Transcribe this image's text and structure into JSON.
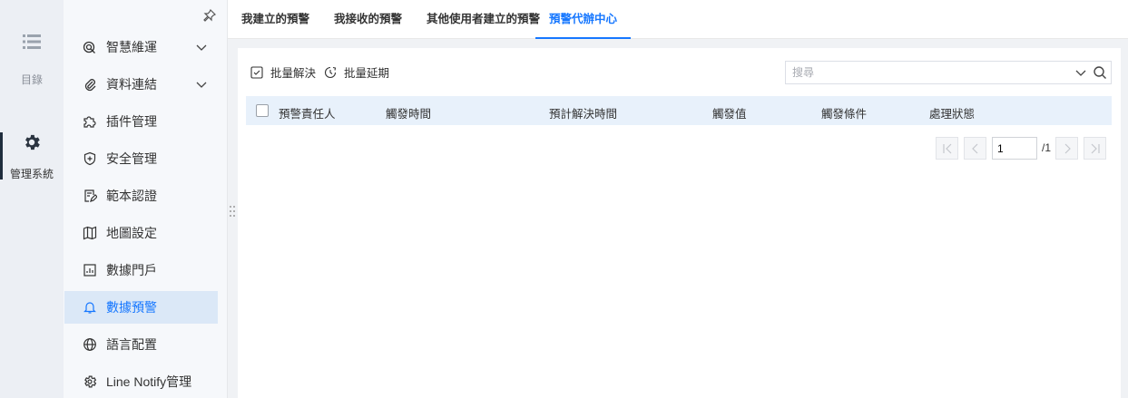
{
  "rail": {
    "items": [
      {
        "label": "目錄",
        "icon": "list-icon"
      },
      {
        "label": "管理系統",
        "icon": "gear-icon"
      }
    ]
  },
  "menu": {
    "items": [
      {
        "label": "智慧維運",
        "icon": "radar-icon",
        "expandable": true
      },
      {
        "label": "資料連結",
        "icon": "paperclip-icon",
        "expandable": true
      },
      {
        "label": "插件管理",
        "icon": "puzzle-icon"
      },
      {
        "label": "安全管理",
        "icon": "shield-icon"
      },
      {
        "label": "範本認證",
        "icon": "certificate-icon"
      },
      {
        "label": "地圖設定",
        "icon": "map-icon"
      },
      {
        "label": "數據門戶",
        "icon": "dashboard-icon"
      },
      {
        "label": "數據預警",
        "icon": "bell-icon",
        "active": true
      },
      {
        "label": "語言配置",
        "icon": "globe-icon"
      },
      {
        "label": "Line Notify管理",
        "icon": "settings-icon"
      }
    ]
  },
  "tabs": [
    {
      "label": "我建立的預警"
    },
    {
      "label": "我接收的預警"
    },
    {
      "label": "其他使用者建立的預警"
    },
    {
      "label": "預警代辦中心",
      "active": true
    }
  ],
  "toolbar": {
    "batch_resolve": "批量解決",
    "batch_delay": "批量延期"
  },
  "search": {
    "placeholder": "搜尋",
    "value": ""
  },
  "table": {
    "columns": [
      "預警責任人",
      "觸發時間",
      "預計解決時間",
      "觸發值",
      "觸發條件",
      "處理狀態"
    ],
    "rows": []
  },
  "pagination": {
    "current_page": "1",
    "total": "/1"
  },
  "colors": {
    "accent": "#1677ff",
    "active_menu_bg": "#dbe8f7",
    "table_header_bg": "#e8f1fb"
  }
}
